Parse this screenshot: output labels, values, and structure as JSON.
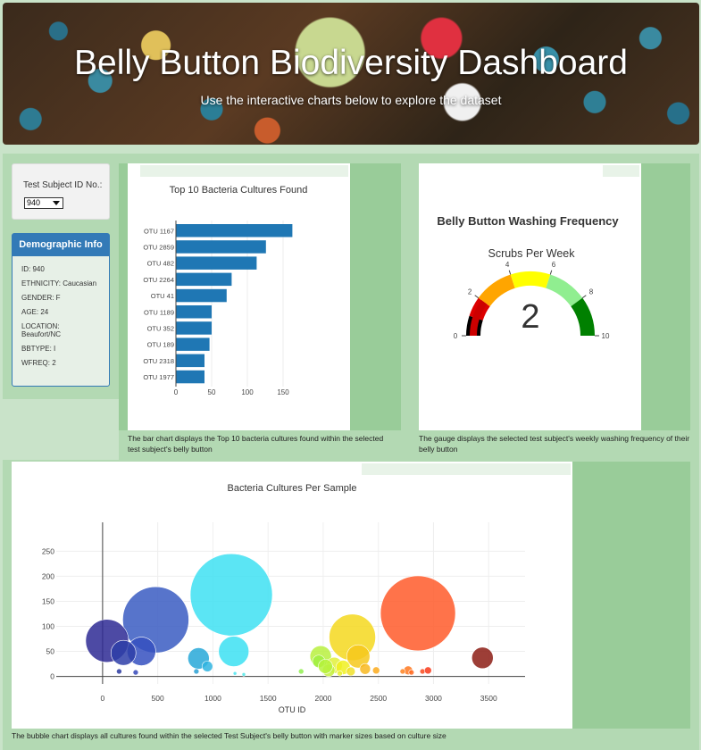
{
  "header": {
    "title": "Belly Button Biodiversity Dashboard",
    "subtitle": "Use the interactive charts below to explore the dataset"
  },
  "selector": {
    "label": "Test Subject ID No.:",
    "value": "940"
  },
  "demo": {
    "title": "Demographic Info",
    "items": [
      "ID: 940",
      "ETHNICITY: Caucasian",
      "GENDER: F",
      "AGE: 24",
      "LOCATION: Beaufort/NC",
      "BBTYPE: I",
      "WFREQ: 2"
    ]
  },
  "captions": {
    "bar": "The bar chart displays the Top 10 bacteria cultures found within the selected test subject's belly button",
    "gauge": "The gauge displays the selected test subject's weekly washing frequency of their belly button",
    "bubble": "The bubble chart displays all cultures found within the selected Test Subject's belly button with marker sizes based on culture size"
  },
  "gauge": {
    "title": "Belly Button Washing Frequency",
    "subtitle": "Scrubs Per Week",
    "value": "2",
    "ticks": [
      "0",
      "2",
      "4",
      "6",
      "8",
      "10"
    ],
    "colors": [
      "#000000",
      "#dd0000",
      "#ffa500",
      "#ffff00",
      "#90ee90",
      "#008000"
    ]
  },
  "chart_data": [
    {
      "type": "bar",
      "title": "Top 10 Bacteria Cultures Found",
      "orientation": "horizontal",
      "categories": [
        "OTU 1167",
        "OTU 2859",
        "OTU 482",
        "OTU 2264",
        "OTU 41",
        "OTU 1189",
        "OTU 352",
        "OTU 189",
        "OTU 2318",
        "OTU 1977"
      ],
      "values": [
        163,
        126,
        113,
        78,
        71,
        50,
        50,
        47,
        40,
        40
      ],
      "xticks": [
        "0",
        "50",
        "100",
        "150"
      ],
      "xlim": [
        0,
        175
      ],
      "color": "#1f77b4"
    },
    {
      "type": "scatter",
      "title": "Bacteria Cultures Per Sample",
      "xlabel": "OTU ID",
      "xticks": [
        "0",
        "500",
        "1000",
        "1500",
        "2000",
        "2500",
        "3000",
        "3500"
      ],
      "yticks": [
        "0",
        "50",
        "100",
        "150",
        "200",
        "250"
      ],
      "xlim": [
        -420,
        3830
      ],
      "ylim": [
        -15,
        272
      ],
      "bubbles": [
        {
          "x": 1167,
          "y": 163,
          "r": 46,
          "c": "#3ee0f2"
        },
        {
          "x": 482,
          "y": 113,
          "r": 37,
          "c": "#3a5cc2"
        },
        {
          "x": 2859,
          "y": 126,
          "r": 42,
          "c": "#ff5a2a"
        },
        {
          "x": 2264,
          "y": 78,
          "r": 26,
          "c": "#f4d81e"
        },
        {
          "x": 41,
          "y": 71,
          "r": 24,
          "c": "#2e2a94"
        },
        {
          "x": 1189,
          "y": 50,
          "r": 17,
          "c": "#3ce0f2"
        },
        {
          "x": 352,
          "y": 50,
          "r": 16,
          "c": "#3550c0"
        },
        {
          "x": 189,
          "y": 47,
          "r": 14,
          "c": "#2e3ea8"
        },
        {
          "x": 2318,
          "y": 40,
          "r": 13,
          "c": "#f6c81c"
        },
        {
          "x": 1977,
          "y": 40,
          "r": 12,
          "c": "#b8f040"
        },
        {
          "x": 870,
          "y": 36,
          "r": 12,
          "c": "#27a8d8"
        },
        {
          "x": 950,
          "y": 20,
          "r": 6,
          "c": "#2fb4e0"
        },
        {
          "x": 3444,
          "y": 37,
          "r": 12,
          "c": "#8c1c14"
        },
        {
          "x": 2100,
          "y": 22,
          "r": 9,
          "c": "#e0f03a"
        },
        {
          "x": 2180,
          "y": 18,
          "r": 8,
          "c": "#f0f020"
        },
        {
          "x": 2050,
          "y": 12,
          "r": 7,
          "c": "#c4f040"
        },
        {
          "x": 2380,
          "y": 15,
          "r": 6,
          "c": "#f8b820"
        },
        {
          "x": 2250,
          "y": 10,
          "r": 5,
          "c": "#f0e02a"
        },
        {
          "x": 1960,
          "y": 30,
          "r": 7,
          "c": "#a0f040"
        },
        {
          "x": 2020,
          "y": 20,
          "r": 8,
          "c": "#b6f23c"
        },
        {
          "x": 2480,
          "y": 12,
          "r": 4,
          "c": "#fbaa1c"
        },
        {
          "x": 1800,
          "y": 10,
          "r": 3,
          "c": "#90f050"
        },
        {
          "x": 2770,
          "y": 12,
          "r": 5,
          "c": "#ff7820"
        },
        {
          "x": 2720,
          "y": 10,
          "r": 3,
          "c": "#ff8220"
        },
        {
          "x": 2900,
          "y": 10,
          "r": 3,
          "c": "#fa4a1c"
        },
        {
          "x": 2950,
          "y": 12,
          "r": 4,
          "c": "#f83a1a"
        },
        {
          "x": 2800,
          "y": 8,
          "r": 3,
          "c": "#ff6a22"
        },
        {
          "x": 150,
          "y": 10,
          "r": 3,
          "c": "#2a3aa0"
        },
        {
          "x": 300,
          "y": 8,
          "r": 3,
          "c": "#3548b8"
        },
        {
          "x": 850,
          "y": 10,
          "r": 3,
          "c": "#29a0d4"
        },
        {
          "x": 1200,
          "y": 6,
          "r": 2,
          "c": "#4ae4f0"
        },
        {
          "x": 1280,
          "y": 4,
          "r": 2,
          "c": "#50e8e8"
        },
        {
          "x": 2150,
          "y": 6,
          "r": 3,
          "c": "#e8f030"
        }
      ]
    }
  ]
}
